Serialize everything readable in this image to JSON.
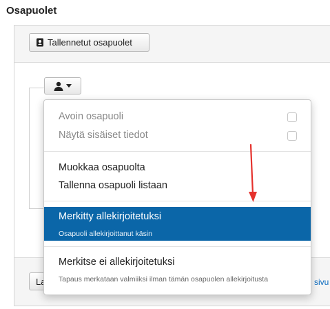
{
  "section_title": "Osapuolet",
  "saved_button_label": "Tallennetut osapuolet",
  "footer": {
    "button_label": "La",
    "link_text": "sivu"
  },
  "dropdown": {
    "items": [
      {
        "label": "Avoin osapuoli",
        "disabled": true,
        "checkbox": false
      },
      {
        "label": "Näytä sisäiset tiedot",
        "disabled": true,
        "checkbox": false
      },
      {
        "label": "Muokkaa osapuolta"
      },
      {
        "label": "Tallenna osapuoli listaan"
      },
      {
        "label": "Merkitty allekirjoitetuksi",
        "description": "Osapuoli allekirjoittanut käsin",
        "selected": true
      },
      {
        "label": "Merkitse ei allekirjoitetuksi",
        "description": "Tapaus merkataan valmiiksi ilman tämän osapuolen allekirjoitusta"
      }
    ]
  },
  "colors": {
    "selected_background": "#0b66a8",
    "annotation_arrow": "#e5322d",
    "link": "#0b6bbf"
  },
  "icons": {
    "saved_button_icon": "address-book-icon",
    "person_button_icon": "person-icon"
  }
}
